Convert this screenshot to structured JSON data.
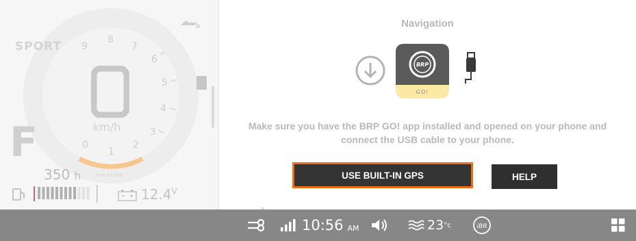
{
  "cluster": {
    "mode": "SPORT",
    "speed": "0",
    "speed_unit": "km/h",
    "gear": "F",
    "hours_value": "350",
    "hours_unit": "h",
    "voltage_value": "12.4",
    "voltage_unit": "V",
    "fuel_level_fraction": 0.75,
    "rpm_label": "rpm x1000",
    "tach_ticks": [
      "0",
      "1",
      "2",
      "3",
      "4",
      "5",
      "6",
      "7",
      "8",
      "9"
    ],
    "colors": {
      "redline": "#e05a7a",
      "tach_arc": "#f7c88e"
    }
  },
  "navigation": {
    "title": "Navigation",
    "app_badge": "GO!",
    "app_logo_text": "BRP",
    "message": "Make sure you have the BRP GO! app installed and opened on your phone and connect the USB cable to your phone.",
    "primary_button": "USE BUILT-IN GPS",
    "secondary_button": "HELP",
    "colors": {
      "focus_border": "#ef6c1c",
      "button_bg": "#343434",
      "app_badge_bg": "#fde9a6"
    }
  },
  "statusbar": {
    "time": "10:56",
    "ampm": "AM",
    "temperature": "23",
    "temperature_unit": "°c",
    "ibr_label": "iBR",
    "icons": [
      "key-icon",
      "signal-icon",
      "speaker-icon",
      "water-temp-icon",
      "ibr-icon",
      "grid-menu-icon"
    ]
  }
}
